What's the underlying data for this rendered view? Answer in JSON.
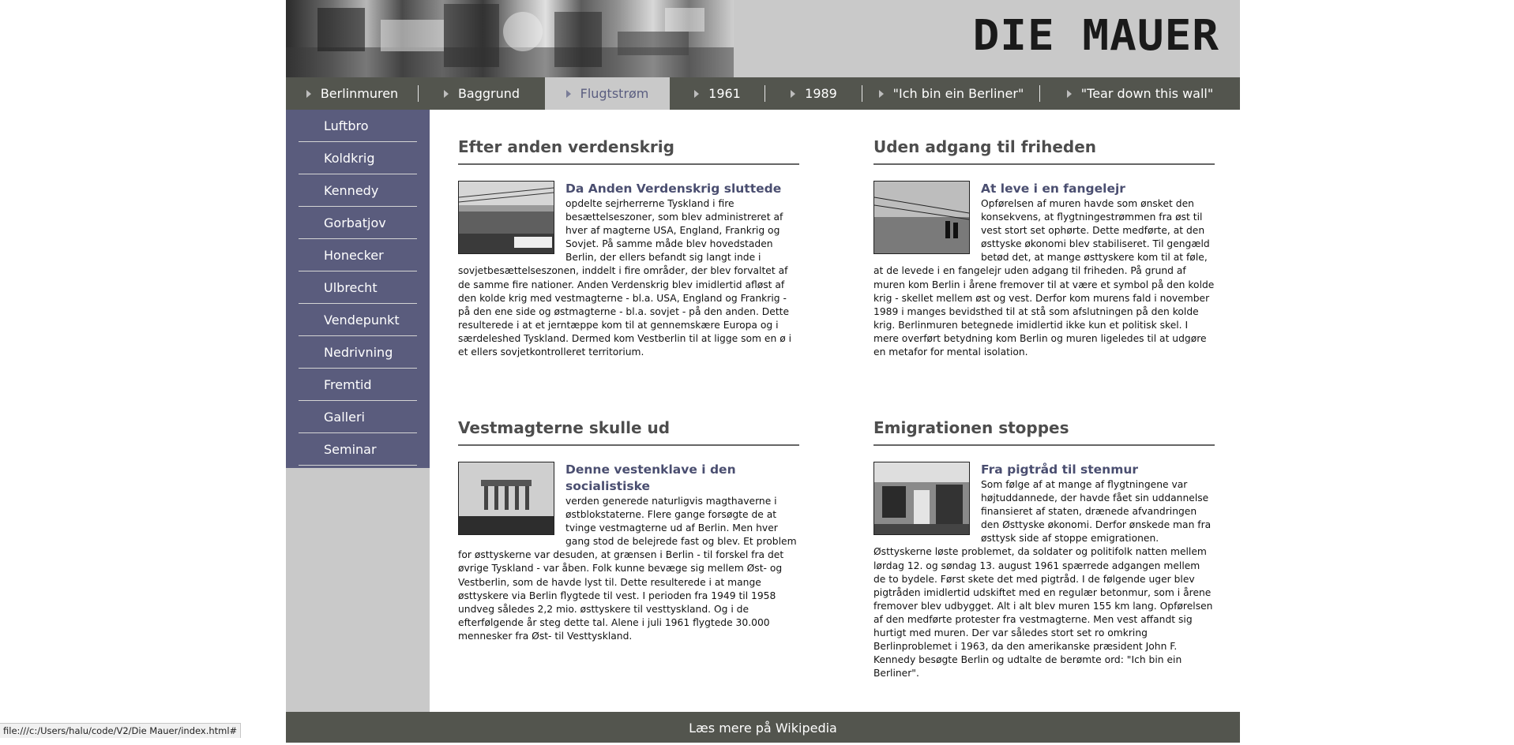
{
  "header": {
    "logo_text": "DIE MAUER",
    "collage_icon": "photo-collage-image"
  },
  "topnav": [
    {
      "label": "Berlinmuren",
      "active": false
    },
    {
      "label": "Baggrund",
      "active": false
    },
    {
      "label": "Flugtstrøm",
      "active": true
    },
    {
      "label": "1961",
      "active": false
    },
    {
      "label": "1989",
      "active": false
    },
    {
      "label": "\"Ich bin ein Berliner\"",
      "active": false
    },
    {
      "label": "\"Tear down this wall\"",
      "active": false
    }
  ],
  "sidebar": {
    "items": [
      {
        "label": "Luftbro"
      },
      {
        "label": "Koldkrig"
      },
      {
        "label": "Kennedy"
      },
      {
        "label": "Gorbatjov"
      },
      {
        "label": "Honecker"
      },
      {
        "label": "Ulbrecht"
      },
      {
        "label": "Vendepunkt"
      },
      {
        "label": "Nedrivning"
      },
      {
        "label": "Fremtid"
      },
      {
        "label": "Galleri"
      },
      {
        "label": "Seminar"
      }
    ]
  },
  "sections": [
    {
      "heading": "Efter anden verdenskrig",
      "article_title": "Da Anden Verdenskrig sluttede",
      "article_body": "opdelte sejrherrerne Tyskland i fire besættelseszoner, som blev administreret af hver af magterne USA, England, Frankrig og Sovjet. På samme måde blev hovedstaden Berlin, der ellers befandt sig langt inde i sovjetbesættelseszonen, inddelt i fire områder, der blev forvaltet af de samme fire nationer. Anden Verdenskrig blev imidlertid afløst af den kolde krig med vestmagterne - bl.a. USA, England og Frankrig - på den ene side og østmagterne - bl.a. sovjet - på den anden. Dette resulterede i at et jerntæppe kom til at gennemskære Europa og i særdeleshed Tyskland. Dermed kom Vestberlin til at ligge som en ø i et ellers sovjetkontrolleret territorium.",
      "image_icon": "berlin-wall-photo"
    },
    {
      "heading": "Uden adgang til friheden",
      "article_title": "At leve i en fangelejr",
      "article_body": "Opførelsen af muren havde som ønsket den konsekvens, at flygtningestrømmen fra øst til vest stort set ophørte. Dette medførte, at den østtyske økonomi blev stabiliseret. Til gengæld betød det, at mange østtyskere kom til at føle, at de levede i en fangelejr uden adgang til friheden. På grund af muren kom Berlin i årene fremover til at være et symbol på den kolde krig - skellet mellem øst og vest. Derfor kom murens fald i november 1989 i manges bevidsthed til at stå som afslutningen på den kolde krig. Berlinmuren betegnede imidlertid ikke kun et politisk skel. I mere overført betydning kom Berlin og muren ligeledes til at udgøre en metafor for mental isolation.",
      "image_icon": "barbed-wire-photo"
    },
    {
      "heading": "Vestmagterne skulle ud",
      "article_title": "Denne vestenklave i den socialistiske",
      "article_body": "verden generede naturligvis magthaverne i østblokstaterne. Flere gange forsøgte de at tvinge vestmagterne ud af Berlin. Men hver gang stod de belejrede fast og blev. Et problem for østtyskerne var desuden, at grænsen i Berlin - til forskel fra det øvrige Tyskland - var åben. Folk kunne bevæge sig mellem Øst- og Vestberlin, som de havde lyst til. Dette resulterede i at mange østtyskere via Berlin flygtede til vest. I perioden fra 1949 til 1958 undveg således 2,2 mio. østtyskere til vesttyskland. Og i de efterfølgende år steg dette tal. Alene i juli 1961 flygtede 30.000 mennesker fra Øst- til Vesttyskland.",
      "image_icon": "brandenburg-gate-photo"
    },
    {
      "heading": "Emigrationen stoppes",
      "article_title": "Fra pigtråd til stenmur",
      "article_body": "Som følge af at mange af flygtningene var højtuddannede, der havde fået sin uddannelse finansieret af staten, drænede afvandringen den Østtyske økonomi. Derfor ønskede man fra østtysk side af stoppe emigrationen. Østtyskerne løste problemet, da soldater og politifolk natten mellem lørdag 12. og søndag 13. august 1961 spærrede adgangen mellem de to bydele. Først skete det med pigtråd. I de følgende uger blev pigtråden imidlertid udskiftet med en regulær betonmur, som i årene fremover blev udbygget. Alt i alt blev muren 155 km lang. Opførelsen af den medførte protester fra vestmagterne. Men vest affandt sig hurtigt med muren. Der var således stort set ro omkring Berlinproblemet i 1963, da den amerikanske præsident John F. Kennedy besøgte Berlin og udtalte de berømte ord: \"Ich bin ein Berliner\".",
      "image_icon": "wall-construction-photo"
    }
  ],
  "footer": {
    "link_label": "Læs mere på Wikipedia"
  },
  "statusbar": {
    "url": "file:///c:/Users/halu/code/V2/Die Mauer/index.html#"
  },
  "colors": {
    "nav_bg": "#53554e",
    "sidebar_bg": "#5a5c7d",
    "header_bg": "#c9c9c9",
    "accent_title": "#4a4e70"
  }
}
